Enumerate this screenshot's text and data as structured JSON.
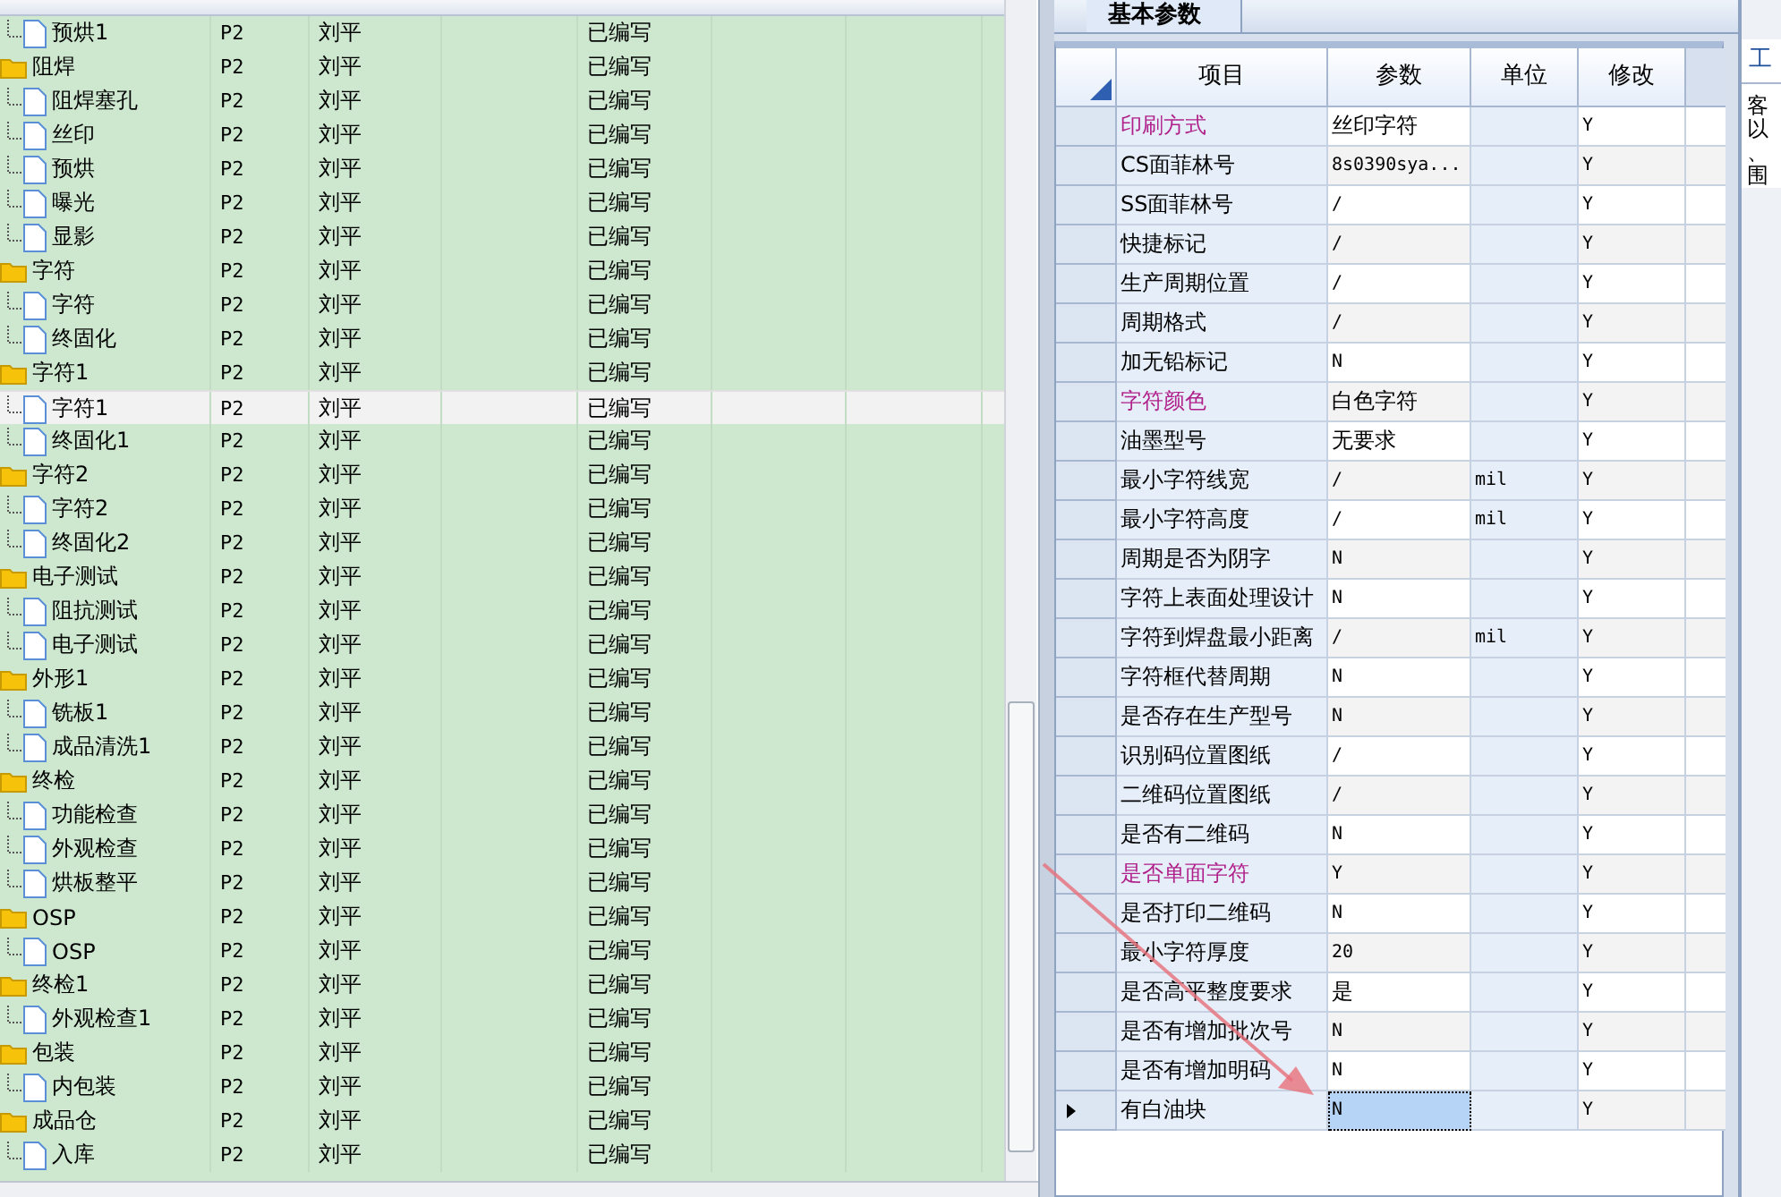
{
  "tree": {
    "rows": [
      {
        "kind": "file",
        "name": "预烘1",
        "bom": "P2",
        "author": "刘平",
        "status": "已编写",
        "selected": false
      },
      {
        "kind": "folder",
        "name": "阻焊",
        "bom": "P2",
        "author": "刘平",
        "status": "已编写",
        "selected": false
      },
      {
        "kind": "file",
        "name": "阻焊塞孔",
        "bom": "P2",
        "author": "刘平",
        "status": "已编写",
        "selected": false
      },
      {
        "kind": "file",
        "name": "丝印",
        "bom": "P2",
        "author": "刘平",
        "status": "已编写",
        "selected": false
      },
      {
        "kind": "file",
        "name": "预烘",
        "bom": "P2",
        "author": "刘平",
        "status": "已编写",
        "selected": false
      },
      {
        "kind": "file",
        "name": "曝光",
        "bom": "P2",
        "author": "刘平",
        "status": "已编写",
        "selected": false
      },
      {
        "kind": "file",
        "name": "显影",
        "bom": "P2",
        "author": "刘平",
        "status": "已编写",
        "selected": false
      },
      {
        "kind": "folder",
        "name": "字符",
        "bom": "P2",
        "author": "刘平",
        "status": "已编写",
        "selected": false
      },
      {
        "kind": "file",
        "name": "字符",
        "bom": "P2",
        "author": "刘平",
        "status": "已编写",
        "selected": false
      },
      {
        "kind": "file",
        "name": "终固化",
        "bom": "P2",
        "author": "刘平",
        "status": "已编写",
        "selected": false
      },
      {
        "kind": "folder",
        "name": "字符1",
        "bom": "P2",
        "author": "刘平",
        "status": "已编写",
        "selected": false
      },
      {
        "kind": "file",
        "name": "字符1",
        "bom": "P2",
        "author": "刘平",
        "status": "已编写",
        "selected": true
      },
      {
        "kind": "file",
        "name": "终固化1",
        "bom": "P2",
        "author": "刘平",
        "status": "已编写",
        "selected": false
      },
      {
        "kind": "folder",
        "name": "字符2",
        "bom": "P2",
        "author": "刘平",
        "status": "已编写",
        "selected": false
      },
      {
        "kind": "file",
        "name": "字符2",
        "bom": "P2",
        "author": "刘平",
        "status": "已编写",
        "selected": false
      },
      {
        "kind": "file",
        "name": "终固化2",
        "bom": "P2",
        "author": "刘平",
        "status": "已编写",
        "selected": false
      },
      {
        "kind": "folder",
        "name": "电子测试",
        "bom": "P2",
        "author": "刘平",
        "status": "已编写",
        "selected": false
      },
      {
        "kind": "file",
        "name": "阻抗测试",
        "bom": "P2",
        "author": "刘平",
        "status": "已编写",
        "selected": false
      },
      {
        "kind": "file",
        "name": "电子测试",
        "bom": "P2",
        "author": "刘平",
        "status": "已编写",
        "selected": false
      },
      {
        "kind": "folder",
        "name": "外形1",
        "bom": "P2",
        "author": "刘平",
        "status": "已编写",
        "selected": false
      },
      {
        "kind": "file",
        "name": "铣板1",
        "bom": "P2",
        "author": "刘平",
        "status": "已编写",
        "selected": false
      },
      {
        "kind": "file",
        "name": "成品清洗1",
        "bom": "P2",
        "author": "刘平",
        "status": "已编写",
        "selected": false
      },
      {
        "kind": "folder",
        "name": "终检",
        "bom": "P2",
        "author": "刘平",
        "status": "已编写",
        "selected": false
      },
      {
        "kind": "file",
        "name": "功能检查",
        "bom": "P2",
        "author": "刘平",
        "status": "已编写",
        "selected": false
      },
      {
        "kind": "file",
        "name": "外观检查",
        "bom": "P2",
        "author": "刘平",
        "status": "已编写",
        "selected": false
      },
      {
        "kind": "file",
        "name": "烘板整平",
        "bom": "P2",
        "author": "刘平",
        "status": "已编写",
        "selected": false
      },
      {
        "kind": "folder",
        "name": "OSP",
        "bom": "P2",
        "author": "刘平",
        "status": "已编写",
        "selected": false
      },
      {
        "kind": "file",
        "name": "OSP",
        "bom": "P2",
        "author": "刘平",
        "status": "已编写",
        "selected": false
      },
      {
        "kind": "folder",
        "name": "终检1",
        "bom": "P2",
        "author": "刘平",
        "status": "已编写",
        "selected": false
      },
      {
        "kind": "file",
        "name": "外观检查1",
        "bom": "P2",
        "author": "刘平",
        "status": "已编写",
        "selected": false
      },
      {
        "kind": "folder",
        "name": "包装",
        "bom": "P2",
        "author": "刘平",
        "status": "已编写",
        "selected": false
      },
      {
        "kind": "file",
        "name": "内包装",
        "bom": "P2",
        "author": "刘平",
        "status": "已编写",
        "selected": false
      },
      {
        "kind": "folder",
        "name": "成品仓",
        "bom": "P2",
        "author": "刘平",
        "status": "已编写",
        "selected": false
      },
      {
        "kind": "file",
        "name": "入库",
        "bom": "P2",
        "author": "刘平",
        "status": "已编写",
        "selected": false
      }
    ]
  },
  "params": {
    "tab": "基本参数",
    "columns": [
      "项目",
      "参数",
      "单位",
      "修改"
    ],
    "rows": [
      {
        "item": "印刷方式",
        "value": "丝印字符",
        "unit": "",
        "edit": "Y",
        "highlighted": true,
        "selected": false
      },
      {
        "item": "CS面菲林号",
        "value": "8s0390sya...",
        "unit": "",
        "edit": "Y",
        "highlighted": false,
        "selected": false
      },
      {
        "item": "SS面菲林号",
        "value": "/",
        "unit": "",
        "edit": "Y",
        "highlighted": false,
        "selected": false
      },
      {
        "item": "快捷标记",
        "value": "/",
        "unit": "",
        "edit": "Y",
        "highlighted": false,
        "selected": false
      },
      {
        "item": "生产周期位置",
        "value": "/",
        "unit": "",
        "edit": "Y",
        "highlighted": false,
        "selected": false
      },
      {
        "item": "周期格式",
        "value": "/",
        "unit": "",
        "edit": "Y",
        "highlighted": false,
        "selected": false
      },
      {
        "item": "加无铅标记",
        "value": "N",
        "unit": "",
        "edit": "Y",
        "highlighted": false,
        "selected": false
      },
      {
        "item": "字符颜色",
        "value": "白色字符",
        "unit": "",
        "edit": "Y",
        "highlighted": true,
        "selected": false
      },
      {
        "item": "油墨型号",
        "value": "无要求",
        "unit": "",
        "edit": "Y",
        "highlighted": false,
        "selected": false
      },
      {
        "item": "最小字符线宽",
        "value": "/",
        "unit": "mil",
        "edit": "Y",
        "highlighted": false,
        "selected": false
      },
      {
        "item": "最小字符高度",
        "value": "/",
        "unit": "mil",
        "edit": "Y",
        "highlighted": false,
        "selected": false
      },
      {
        "item": "周期是否为阴字",
        "value": "N",
        "unit": "",
        "edit": "Y",
        "highlighted": false,
        "selected": false
      },
      {
        "item": "字符上表面处理设计",
        "value": "N",
        "unit": "",
        "edit": "Y",
        "highlighted": false,
        "selected": false
      },
      {
        "item": "字符到焊盘最小距离",
        "value": "/",
        "unit": "mil",
        "edit": "Y",
        "highlighted": false,
        "selected": false
      },
      {
        "item": "字符框代替周期",
        "value": "N",
        "unit": "",
        "edit": "Y",
        "highlighted": false,
        "selected": false
      },
      {
        "item": "是否存在生产型号",
        "value": "N",
        "unit": "",
        "edit": "Y",
        "highlighted": false,
        "selected": false
      },
      {
        "item": "识别码位置图纸",
        "value": "/",
        "unit": "",
        "edit": "Y",
        "highlighted": false,
        "selected": false
      },
      {
        "item": "二维码位置图纸",
        "value": "/",
        "unit": "",
        "edit": "Y",
        "highlighted": false,
        "selected": false
      },
      {
        "item": "是否有二维码",
        "value": "N",
        "unit": "",
        "edit": "Y",
        "highlighted": false,
        "selected": false
      },
      {
        "item": "是否单面字符",
        "value": "Y",
        "unit": "",
        "edit": "Y",
        "highlighted": true,
        "selected": false
      },
      {
        "item": "是否打印二维码",
        "value": "N",
        "unit": "",
        "edit": "Y",
        "highlighted": false,
        "selected": false
      },
      {
        "item": "最小字符厚度",
        "value": "20",
        "unit": "",
        "edit": "Y",
        "highlighted": false,
        "selected": false
      },
      {
        "item": "是否高平整度要求",
        "value": "是",
        "unit": "",
        "edit": "Y",
        "highlighted": false,
        "selected": false
      },
      {
        "item": "是否有增加批次号",
        "value": "N",
        "unit": "",
        "edit": "Y",
        "highlighted": false,
        "selected": false
      },
      {
        "item": "是否有增加明码",
        "value": "N",
        "unit": "",
        "edit": "Y",
        "highlighted": false,
        "selected": false
      },
      {
        "item": "有白油块",
        "value": "N",
        "unit": "",
        "edit": "Y",
        "highlighted": false,
        "selected": true
      }
    ]
  },
  "side": {
    "tab": "工",
    "lines": [
      "客",
      "以",
      "、",
      "围"
    ]
  }
}
